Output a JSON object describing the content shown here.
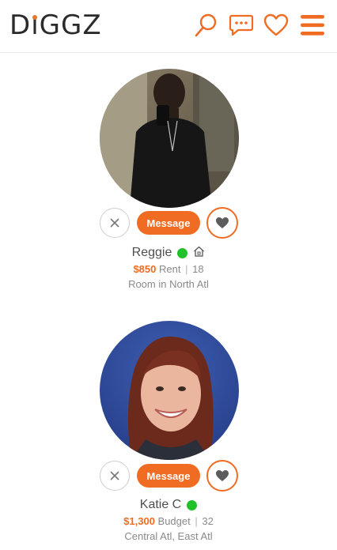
{
  "app": {
    "logo_text": "DiGGZ",
    "accent": "#ef6c22"
  },
  "header": {
    "icons": [
      "search-icon",
      "chat-icon",
      "heart-icon",
      "menu-icon"
    ]
  },
  "profiles": [
    {
      "name": "Reggie",
      "online": true,
      "has_home_badge": true,
      "price": "$850",
      "price_type": "Rent",
      "age": "18",
      "location": "Room in North Atl",
      "message_label": "Message"
    },
    {
      "name": "Katie C",
      "online": true,
      "has_home_badge": false,
      "price": "$1,300",
      "price_type": "Budget",
      "age": "32",
      "location": "Central Atl, East Atl",
      "message_label": "Message"
    }
  ]
}
